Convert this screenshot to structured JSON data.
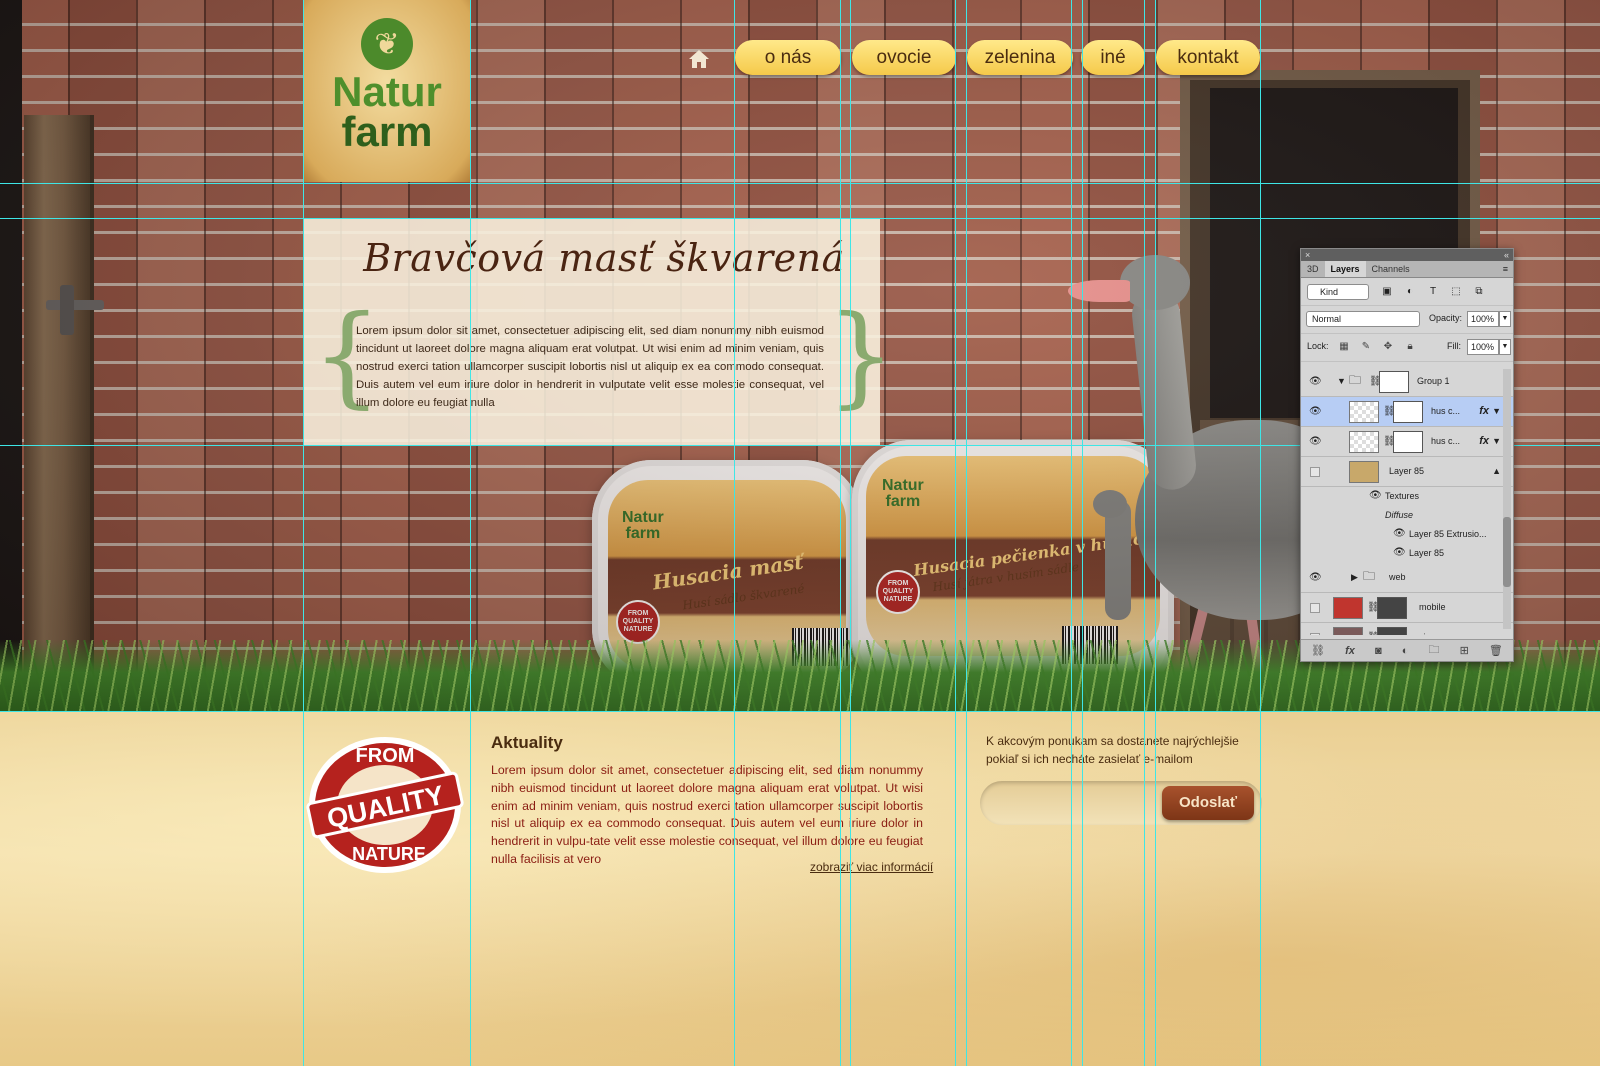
{
  "site": {
    "logo": {
      "line1": "Natur",
      "line2": "farm",
      "icon": "leaf-icon"
    },
    "nav": {
      "home_icon": "home-icon",
      "items": [
        "o nás",
        "ovocie",
        "zelenina",
        "iné",
        "kontakt"
      ]
    },
    "hero": {
      "title": "Bravčová masť škvarená",
      "text": "Lorem ipsum dolor sit amet, consectetuer adipiscing elit, sed diam nonummy nibh euismod tincidunt ut laoreet dolore magna aliquam erat volutpat. Ut wisi enim ad minim veniam, quis nostrud exerci tation ullamcorper suscipit lobortis nisl ut aliquip ex ea commodo consequat. Duis autem vel eum iriure dolor in hendrerit in vulputate velit esse molestie consequat, vel illum dolore eu feugiat nulla",
      "products": [
        {
          "brand1": "Natur",
          "brand2": "farm",
          "title": "Husacia masť",
          "sub": "Husí sádlo škvarené",
          "badge": "FROM QUALITY NATURE"
        },
        {
          "brand1": "Natur",
          "brand2": "farm",
          "title": "Husacia pečienka v husacej masti",
          "sub": "Husí játra v husím sádle",
          "badge": "FROM QUALITY NATURE"
        }
      ]
    },
    "badge": {
      "top": "FROM",
      "middle": "QUALITY",
      "bottom": "NATURE"
    },
    "news": {
      "title": "Aktuality",
      "text": "Lorem ipsum dolor sit amet, consectetuer adipiscing elit, sed diam nonummy nibh euismod tincidunt ut laoreet dolore magna aliquam erat volutpat. Ut wisi enim ad minim veniam, quis nostrud exerci tation ullamcorper suscipit lobortis nisl ut aliquip ex ea commodo consequat. Duis autem vel eum iriure dolor in hendrerit in vulpu-tate velit esse molestie consequat, vel illum dolore eu feugiat nulla facilisis at vero",
      "more": "zobraziť viac informácií"
    },
    "newsletter": {
      "text": "K akcovým ponukam sa dostanete najrýchlejšie pokiaľ si ich necháte zasielať e-mailom",
      "input_value": "",
      "button": "Odoslať"
    }
  },
  "layers_panel": {
    "close": "×",
    "collapse": "«",
    "tabs": [
      "3D",
      "Layers",
      "Channels"
    ],
    "active_tab": "Layers",
    "filter_kind": "Kind",
    "blend_mode": "Normal",
    "opacity_label": "Opacity:",
    "opacity": "100%",
    "lock_label": "Lock:",
    "fill_label": "Fill:",
    "fill": "100%",
    "layers": [
      {
        "name": "Group 1",
        "visible": true
      },
      {
        "name": "hus c...",
        "visible": true,
        "selected": true,
        "fx": "fx"
      },
      {
        "name": "hus c...",
        "visible": true,
        "fx": "fx"
      },
      {
        "name": "Layer 85",
        "visible": false
      },
      {
        "name": "Textures"
      },
      {
        "name": "Diffuse"
      },
      {
        "name": "Layer 85 Extrusio..."
      },
      {
        "name": "Layer 85"
      },
      {
        "name": "web",
        "visible": true
      },
      {
        "name": "mobile",
        "visible": false
      },
      {
        "name": "vino",
        "visible": false
      }
    ]
  },
  "colors": {
    "guide": "#3ee6e6",
    "nav_button": "#f5c94a",
    "news_text": "#8a1c12",
    "send_button": "#8f401e",
    "logo_green": "#4f8f2c"
  }
}
